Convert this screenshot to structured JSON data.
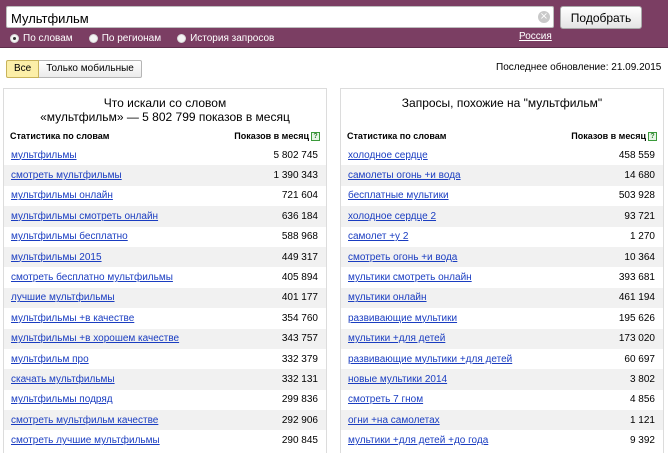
{
  "search": {
    "value": "Мультфильм",
    "submit_label": "Подобрать",
    "clear_glyph": "×"
  },
  "modes": [
    {
      "label": "По словам",
      "checked": true
    },
    {
      "label": "По регионам",
      "checked": false
    },
    {
      "label": "История запросов",
      "checked": false
    }
  ],
  "region_label": "Россия",
  "filters": {
    "all_label": "Все",
    "mobile_label": "Только мобильные"
  },
  "last_update": "Последнее обновление: 21.09.2015",
  "left_panel": {
    "title_line1": "Что искали со словом",
    "title_line2": "«мультфильм» — 5 802 799 показов в месяц",
    "col_words": "Статистика по словам",
    "col_shows": "Показов в месяц",
    "rows": [
      {
        "phrase": "мультфильмы",
        "count": "5 802 745"
      },
      {
        "phrase": "смотреть мультфильмы",
        "count": "1 390 343"
      },
      {
        "phrase": "мультфильмы онлайн",
        "count": "721 604"
      },
      {
        "phrase": "мультфильмы смотреть онлайн",
        "count": "636 184"
      },
      {
        "phrase": "мультфильмы бесплатно",
        "count": "588 968"
      },
      {
        "phrase": "мультфильмы 2015",
        "count": "449 317"
      },
      {
        "phrase": "смотреть бесплатно мультфильмы",
        "count": "405 894"
      },
      {
        "phrase": "лучшие мультфильмы",
        "count": "401 177"
      },
      {
        "phrase": "мультфильмы +в качестве",
        "count": "354 760"
      },
      {
        "phrase": "мультфильмы +в хорошем качестве",
        "count": "343 757"
      },
      {
        "phrase": "мультфильм про",
        "count": "332 379"
      },
      {
        "phrase": "скачать мультфильмы",
        "count": "332 131"
      },
      {
        "phrase": "мультфильмы подряд",
        "count": "299 836"
      },
      {
        "phrase": "смотреть мультфильм качестве",
        "count": "292 906"
      },
      {
        "phrase": "смотреть лучшие мультфильмы",
        "count": "290 845"
      }
    ]
  },
  "right_panel": {
    "title": "Запросы, похожие на \"мультфильм\"",
    "col_words": "Статистика по словам",
    "col_shows": "Показов в месяц",
    "rows": [
      {
        "phrase": "холодное сердце",
        "count": "458 559"
      },
      {
        "phrase": "самолеты огонь +и вода",
        "count": "14 680"
      },
      {
        "phrase": "бесплатные мультики",
        "count": "503 928"
      },
      {
        "phrase": "холодное сердце 2",
        "count": "93 721"
      },
      {
        "phrase": "самолет +у 2",
        "count": "1 270"
      },
      {
        "phrase": "смотреть огонь +и вода",
        "count": "10 364"
      },
      {
        "phrase": "мультики смотреть онлайн",
        "count": "393 681"
      },
      {
        "phrase": "мультики онлайн",
        "count": "461 194"
      },
      {
        "phrase": "развивающие мультики",
        "count": "195 626"
      },
      {
        "phrase": "мультики +для детей",
        "count": "173 020"
      },
      {
        "phrase": "развивающие мультики +для детей",
        "count": "60 697"
      },
      {
        "phrase": "новые мультики 2014",
        "count": "3 802"
      },
      {
        "phrase": "смотреть 7 гном",
        "count": "4 856"
      },
      {
        "phrase": "огни +на самолетах",
        "count": "1 121"
      },
      {
        "phrase": "мультики +для детей +до года",
        "count": "9 392"
      }
    ]
  },
  "colors": {
    "topbar": "#7b3e63",
    "link": "#1a3dc1",
    "active_filter": "#fcefa8"
  }
}
